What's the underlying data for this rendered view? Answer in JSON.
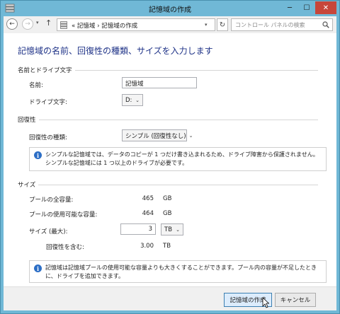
{
  "window": {
    "title": "記憶域の作成",
    "controls": {
      "minimize": "─",
      "maximize": "☐",
      "close": "✕"
    }
  },
  "nav": {
    "back": "←",
    "forward": "→",
    "dropdown": "▾",
    "up": "↑",
    "breadcrumb": "« 記憶域 › 記憶域の作成",
    "address_dropdown": "▾",
    "refresh": "↻",
    "search_placeholder": "コントロール パネルの検索"
  },
  "heading": "記憶域の名前、回復性の種類、サイズを入力します",
  "name_group": {
    "title": "名前とドライブ文字",
    "name_label": "名前:",
    "name_value": "記憶域",
    "drive_label": "ドライブ文字:",
    "drive_value": "D:"
  },
  "resiliency_group": {
    "title": "回復性",
    "type_label": "回復性の種類:",
    "type_value": "シンプル (回復性なし)",
    "info": "シンプルな記憶域では、データのコピーが 1 つだけ書き込まれるため、ドライブ障害から保護されません。シンプルな記憶域には 1 つ以上のドライブが必要です。"
  },
  "size_group": {
    "title": "サイズ",
    "total_label": "プールの全容量:",
    "total_value": "465",
    "total_unit": "GB",
    "available_label": "プールの使用可能な容量:",
    "available_value": "464",
    "available_unit": "GB",
    "max_label": "サイズ (最大):",
    "max_value": "3",
    "max_unit": "TB",
    "incl_label": "回復性を含む:",
    "incl_value": "3.00",
    "incl_unit": "TB",
    "info": "記憶域は記憶域プールの使用可能な容量よりも大きくすることができます。プール内の容量が不足したときに、ドライブを追加できます。"
  },
  "footer": {
    "create_button": "記憶域の作成",
    "cancel_button": "キャンセル"
  },
  "colors": {
    "window_frame": "#70b8d6",
    "heading": "#1e3287",
    "close_button": "#c7463a",
    "info_icon": "#2d6fc6"
  }
}
